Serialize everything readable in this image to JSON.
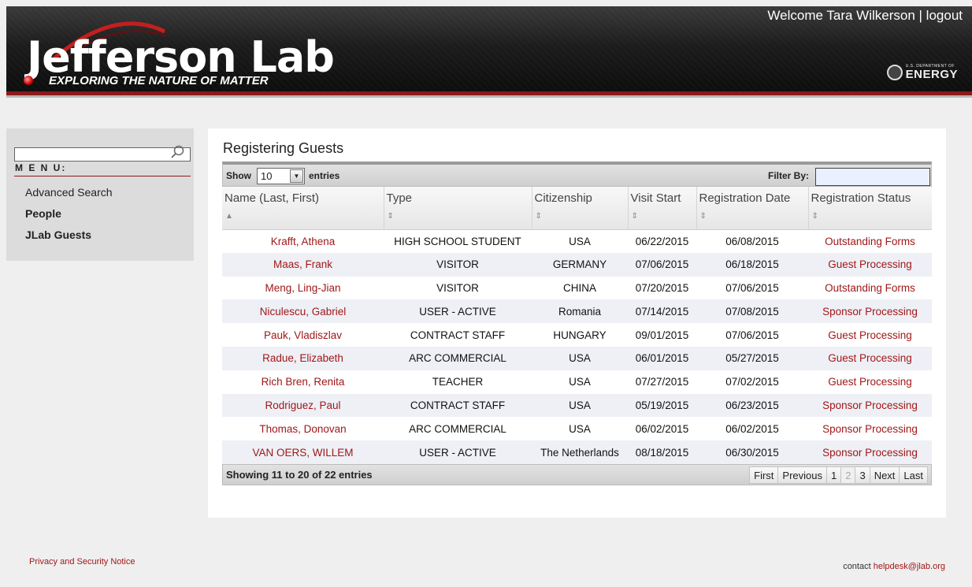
{
  "header": {
    "welcome_text": "Welcome Tara Wilkerson",
    "separator": "|",
    "logout_label": "logout",
    "logo_title": "Jefferson Lab",
    "logo_tagline": "EXPLORING THE NATURE OF MATTER",
    "doe_small": "U.S. DEPARTMENT OF",
    "doe_big": "ENERGY",
    "accent_color": "#8b1a1a"
  },
  "sidebar": {
    "search_value": "",
    "menu_label": "M E N U:",
    "items": [
      {
        "label": "Advanced Search"
      },
      {
        "label": "People"
      },
      {
        "label": "JLab Guests"
      }
    ]
  },
  "main": {
    "title": "Registering Guests",
    "show_label": "Show",
    "page_size": "10",
    "entries_label": "entries",
    "filter_label": "Filter By:",
    "filter_value": "",
    "columns": [
      "Name (Last, First)",
      "Type",
      "Citizenship",
      "Visit Start",
      "Registration Date",
      "Registration Status"
    ],
    "rows": [
      {
        "name": "Krafft, Athena",
        "type": "HIGH SCHOOL STUDENT",
        "citizenship": "USA",
        "visit_start": "06/22/2015",
        "reg_date": "06/08/2015",
        "status": "Outstanding Forms"
      },
      {
        "name": "Maas, Frank",
        "type": "VISITOR",
        "citizenship": "GERMANY",
        "visit_start": "07/06/2015",
        "reg_date": "06/18/2015",
        "status": "Guest Processing"
      },
      {
        "name": "Meng, Ling-Jian",
        "type": "VISITOR",
        "citizenship": "CHINA",
        "visit_start": "07/20/2015",
        "reg_date": "07/06/2015",
        "status": "Outstanding Forms"
      },
      {
        "name": "Niculescu, Gabriel",
        "type": "USER - ACTIVE",
        "citizenship": "Romania",
        "visit_start": "07/14/2015",
        "reg_date": "07/08/2015",
        "status": "Sponsor Processing"
      },
      {
        "name": "Pauk, Vladiszlav",
        "type": "CONTRACT STAFF",
        "citizenship": "HUNGARY",
        "visit_start": "09/01/2015",
        "reg_date": "07/06/2015",
        "status": "Guest Processing"
      },
      {
        "name": "Radue, Elizabeth",
        "type": "ARC COMMERCIAL",
        "citizenship": "USA",
        "visit_start": "06/01/2015",
        "reg_date": "05/27/2015",
        "status": "Guest Processing"
      },
      {
        "name": "Rich Bren, Renita",
        "type": "TEACHER",
        "citizenship": "USA",
        "visit_start": "07/27/2015",
        "reg_date": "07/02/2015",
        "status": "Guest Processing"
      },
      {
        "name": "Rodriguez, Paul",
        "type": "CONTRACT STAFF",
        "citizenship": "USA",
        "visit_start": "05/19/2015",
        "reg_date": "06/23/2015",
        "status": "Sponsor Processing"
      },
      {
        "name": "Thomas, Donovan",
        "type": "ARC COMMERCIAL",
        "citizenship": "USA",
        "visit_start": "06/02/2015",
        "reg_date": "06/02/2015",
        "status": "Sponsor Processing"
      },
      {
        "name": "VAN OERS, WILLEM",
        "type": "USER - ACTIVE",
        "citizenship": "The Netherlands",
        "visit_start": "08/18/2015",
        "reg_date": "06/30/2015",
        "status": "Sponsor Processing"
      }
    ],
    "showing_text": "Showing 11 to 20 of 22 entries",
    "pager": {
      "first": "First",
      "previous": "Previous",
      "pages": [
        "1",
        "2",
        "3"
      ],
      "current_page": "2",
      "next": "Next",
      "last": "Last"
    }
  },
  "footer": {
    "privacy_label": "Privacy and Security Notice",
    "contact_prefix": "contact",
    "contact_email": "helpdesk@jlab.org"
  }
}
